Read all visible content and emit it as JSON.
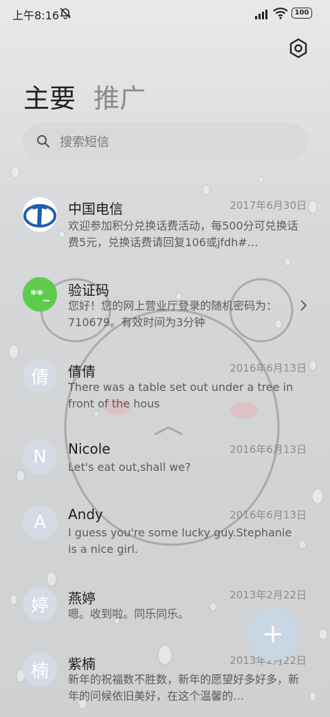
{
  "status_bar": {
    "time": "上午8:16",
    "battery": "100"
  },
  "tabs": [
    {
      "label": "主要"
    },
    {
      "label": "推广"
    }
  ],
  "search": {
    "placeholder": "搜索短信"
  },
  "conversations": [
    {
      "name": "中国电信",
      "date": "2017年6月30日",
      "preview": "欢迎参加积分兑换话费活动，每500分可兑换话费5元，兑换话费请回复106或jfdh#…",
      "avatar": "telecom-logo"
    },
    {
      "name": "验证码",
      "date": "",
      "preview": "您好！您的网上营业厅登录的随机密码为：710679。有效时间为3分钟",
      "avatar": "**_"
    },
    {
      "name": "倩倩",
      "date": "2016年6月13日",
      "preview": "There was a table set out under a tree in front of the hous",
      "avatar": "倩"
    },
    {
      "name": "Nicole",
      "date": "2016年6月13日",
      "preview": "Let's eat out,shall we?",
      "avatar": "N"
    },
    {
      "name": "Andy",
      "date": "2016年6月13日",
      "preview": "I guess you're some lucky guy.Stephanie is a nice girl.",
      "avatar": "A"
    },
    {
      "name": "燕婷",
      "date": "2013年2月22日",
      "preview": "嗯。收到啦。同乐同乐。",
      "avatar": "婷"
    },
    {
      "name": "紫楠",
      "date": "2013年2月22日",
      "preview": "新年的祝福数不胜数，新年的愿望好多好多，新年的问候依旧美好，在这个温馨的…",
      "avatar": "楠"
    }
  ],
  "colors": {
    "verification_avatar": "#5ecb4f",
    "telecom_blue": "#1f5fae",
    "fab": "#c8d6e4"
  },
  "icons": {
    "settings": "hexagon-gear-icon",
    "search": "search-icon",
    "fab": "plus-icon",
    "mute": "mute-icon",
    "signal": "signal-icon",
    "wifi": "wifi-icon"
  }
}
